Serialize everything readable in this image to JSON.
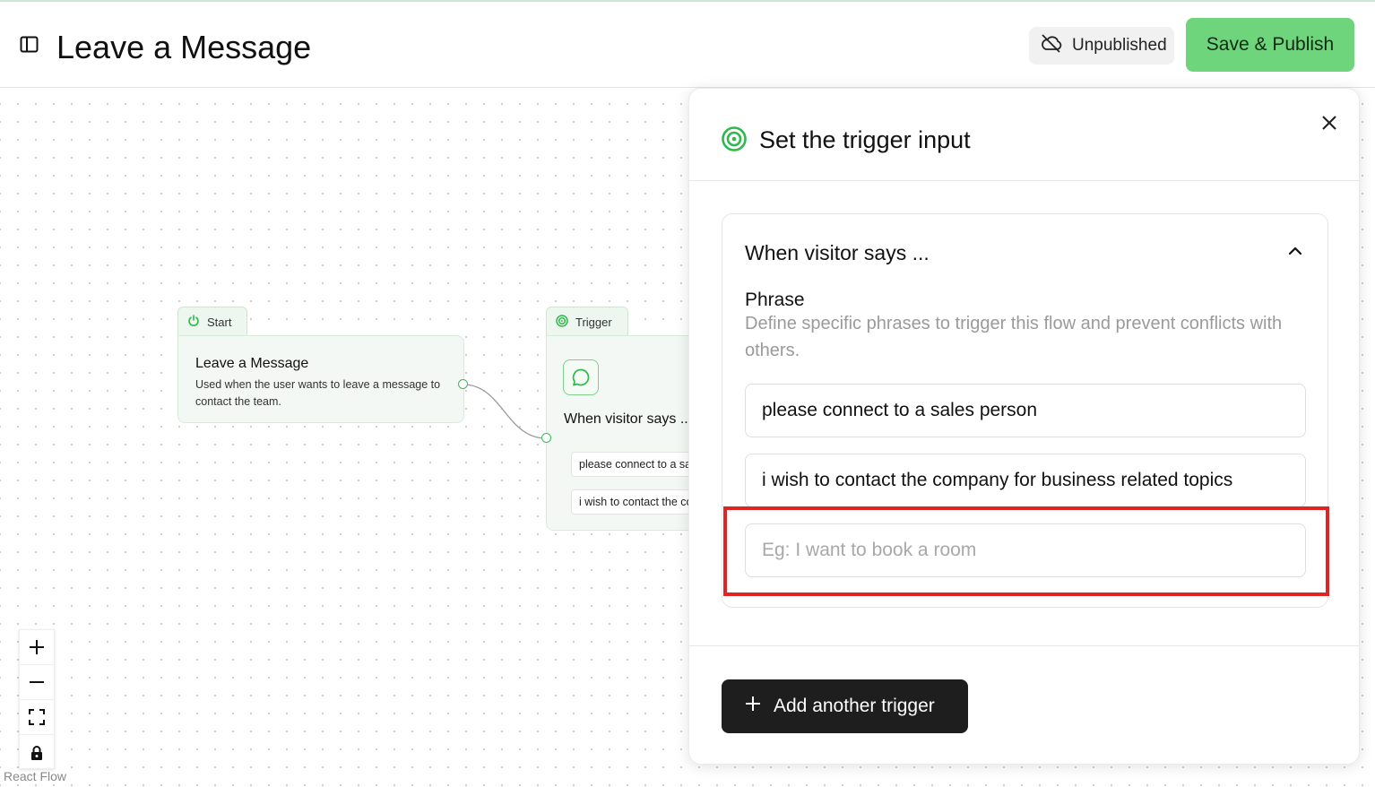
{
  "header": {
    "title": "Leave a Message",
    "status_label": "Unpublished",
    "publish_label": "Save & Publish"
  },
  "flow": {
    "start_node": {
      "tab_label": "Start",
      "title": "Leave a Message",
      "description": "Used when the user wants to leave a message to contact the team."
    },
    "trigger_node": {
      "tab_label": "Trigger",
      "title": "When visitor says ...",
      "phrases": [
        "please connect to a sales person",
        "i wish to contact the company for business related topics"
      ]
    },
    "attribution": "React Flow"
  },
  "panel": {
    "title": "Set the trigger input",
    "card_title": "When visitor says ...",
    "phrase_label": "Phrase",
    "phrase_help": "Define specific phrases to trigger this flow and prevent conflicts with others.",
    "phrases": [
      "please connect to a sales person",
      "i wish to contact the company for business related topics"
    ],
    "new_phrase_placeholder": "Eg: I want to book a room",
    "add_trigger_label": "Add another trigger"
  },
  "colors": {
    "accent_green": "#6ed57c",
    "icon_green": "#2fb84e",
    "highlight_red": "#e02424",
    "dark_button": "#1e1e1e"
  },
  "icons": [
    "sidebar-toggle-icon",
    "cloud-off-icon",
    "power-icon",
    "target-icon",
    "message-circle-icon",
    "close-icon",
    "chevron-up-icon",
    "plus-icon",
    "zoom-in-icon",
    "zoom-out-icon",
    "fit-view-icon",
    "lock-icon"
  ]
}
